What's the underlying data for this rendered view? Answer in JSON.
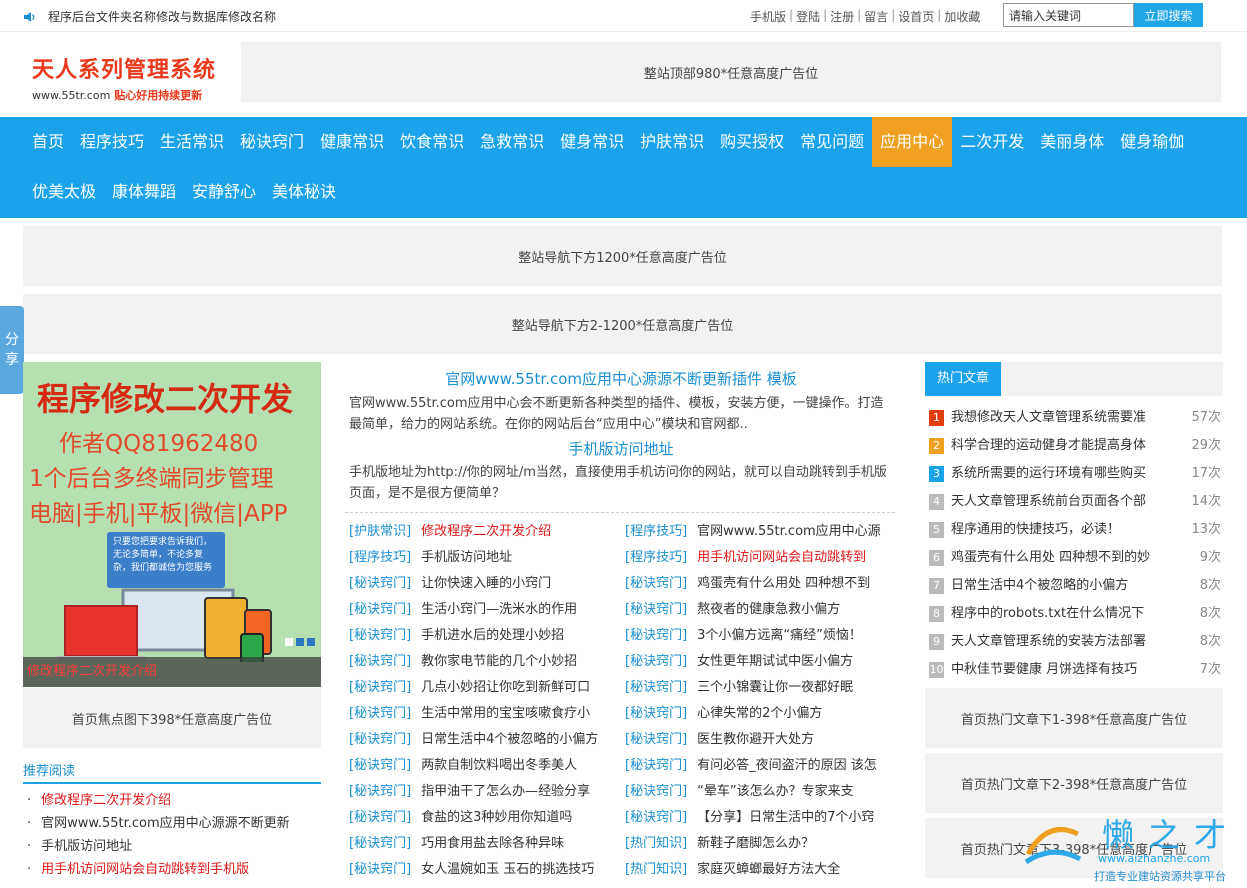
{
  "topbar": {
    "notice": "程序后台文件夹名称修改与数据库修改名称",
    "links": [
      "手机版",
      "登陆",
      "注册",
      "留言",
      "设首页",
      "加收藏"
    ],
    "search_placeholder": "请输入关键词",
    "search_button": "立即搜索"
  },
  "header": {
    "logo_title": "天人系列管理系统",
    "logo_domain": "www.55tr.com",
    "logo_slogan": "贴心好用持续更新",
    "top_ad": "整站顶部980*任意高度广告位"
  },
  "nav": {
    "row1": [
      "首页",
      "程序技巧",
      "生活常识",
      "秘诀窍门",
      "健康常识",
      "饮食常识",
      "急救常识",
      "健身常识",
      "护肤常识",
      "购买授权",
      "常见问题",
      "应用中心",
      "二次开发",
      "美丽身体",
      "健身瑜伽"
    ],
    "row2": [
      "优美太极",
      "康体舞蹈",
      "安静舒心",
      "美体秘诀"
    ],
    "active": "应用中心"
  },
  "ads": {
    "nav_ad1": "整站导航下方1200*任意高度广告位",
    "nav_ad2": "整站导航下方2-1200*任意高度广告位",
    "focus_ad": "首页焦点图下398*任意高度广告位",
    "hot_ad1": "首页热门文章下1-398*任意高度广告位",
    "hot_ad2": "首页热门文章下2-398*任意高度广告位",
    "hot_ad3": "首页热门文章下3-398*任意高度广告位"
  },
  "share": {
    "line1": "分",
    "line2": "享"
  },
  "focus": {
    "title": "程序修改二次开发",
    "author": "作者QQ81962480",
    "line3": "1个后台多终端同步管理",
    "line4": "电脑|手机|平板|微信|APP",
    "bubble": "只要您把要求告诉我们，无论多简单，不论多复杂，我们都诚信为您服务",
    "caption": "修改程序二次开发介绍"
  },
  "recommend": {
    "title": "推荐阅读",
    "items": [
      {
        "text": "修改程序二次开发介绍",
        "red": true
      },
      {
        "text": "官网www.55tr.com应用中心源源不断更新",
        "red": false
      },
      {
        "text": "手机版访问地址",
        "red": false
      },
      {
        "text": "用手机访问网站会自动跳转到手机版",
        "red": true
      }
    ]
  },
  "headline1": {
    "title": "官网www.55tr.com应用中心源源不断更新插件 模板",
    "desc": "官网www.55tr.com应用中心会不断更新各种类型的插件、模板，安装方便，一键操作。打造最简单，给力的网站系统。在你的网站后台“应用中心”模块和官网都.."
  },
  "headline2": {
    "title": "手机版访问地址",
    "desc": "手机版地址为http://你的网址/m当然，直接使用手机访问你的网站，就可以自动跳转到手机版页面，是不是很方便简单？"
  },
  "list_left": [
    {
      "cat": "[护肤常识]",
      "title": "修改程序二次开发介绍",
      "red": true
    },
    {
      "cat": "[程序技巧]",
      "title": "手机版访问地址",
      "red": false
    },
    {
      "cat": "[秘诀窍门]",
      "title": "让你快速入睡的小窍门",
      "red": false
    },
    {
      "cat": "[秘诀窍门]",
      "title": "生活小窍门—洗米水的作用",
      "red": false
    },
    {
      "cat": "[秘诀窍门]",
      "title": "手机进水后的处理小妙招",
      "red": false
    },
    {
      "cat": "[秘诀窍门]",
      "title": "教你家电节能的几个小妙招",
      "red": false
    },
    {
      "cat": "[秘诀窍门]",
      "title": "几点小妙招让你吃到新鲜可口",
      "red": false
    },
    {
      "cat": "[秘诀窍门]",
      "title": "生活中常用的宝宝咳嗽食疗小",
      "red": false
    },
    {
      "cat": "[秘诀窍门]",
      "title": "日常生活中4个被忽略的小偏方",
      "red": false
    },
    {
      "cat": "[秘诀窍门]",
      "title": "两款自制饮料喝出冬季美人",
      "red": false
    },
    {
      "cat": "[秘诀窍门]",
      "title": "指甲油干了怎么办—经验分享",
      "red": false
    },
    {
      "cat": "[秘诀窍门]",
      "title": "食盐的这3种妙用你知道吗",
      "red": false
    },
    {
      "cat": "[秘诀窍门]",
      "title": "巧用食用盐去除各种异味",
      "red": false
    },
    {
      "cat": "[秘诀窍门]",
      "title": "女人温婉如玉 玉石的挑选技巧",
      "red": false
    }
  ],
  "list_right": [
    {
      "cat": "[程序技巧]",
      "title": "官网www.55tr.com应用中心源",
      "red": false
    },
    {
      "cat": "[程序技巧]",
      "title": "用手机访问网站会自动跳转到",
      "red": true
    },
    {
      "cat": "[秘诀窍门]",
      "title": "鸡蛋壳有什么用处 四种想不到",
      "red": false
    },
    {
      "cat": "[秘诀窍门]",
      "title": "熬夜者的健康急救小偏方",
      "red": false
    },
    {
      "cat": "[秘诀窍门]",
      "title": "3个小偏方远离“痛经”烦恼！",
      "red": false
    },
    {
      "cat": "[秘诀窍门]",
      "title": "女性更年期试试中医小偏方",
      "red": false
    },
    {
      "cat": "[秘诀窍门]",
      "title": "三个小锦囊让你一夜都好眠",
      "red": false
    },
    {
      "cat": "[秘诀窍门]",
      "title": "心律失常的2个小偏方",
      "red": false
    },
    {
      "cat": "[秘诀窍门]",
      "title": "医生教你避开大处方",
      "red": false
    },
    {
      "cat": "[秘诀窍门]",
      "title": "有问必答_夜间盗汗的原因 该怎",
      "red": false
    },
    {
      "cat": "[秘诀窍门]",
      "title": "“晕车”该怎么办？专家来支",
      "red": false
    },
    {
      "cat": "[秘诀窍门]",
      "title": "【分享】日常生活中的7个小窍",
      "red": false
    },
    {
      "cat": "[热门知识]",
      "title": "新鞋子磨脚怎么办？",
      "red": false
    },
    {
      "cat": "[热门知识]",
      "title": "家庭灭蟑螂最好方法大全",
      "red": false
    }
  ],
  "hot": {
    "tab": "热门文章",
    "items": [
      {
        "n": "1",
        "title": "我想修改天人文章管理系统需要准",
        "count": "57次"
      },
      {
        "n": "2",
        "title": "科学合理的运动健身才能提高身体",
        "count": "29次"
      },
      {
        "n": "3",
        "title": "系统所需要的运行环境有哪些购买",
        "count": "17次"
      },
      {
        "n": "4",
        "title": "天人文章管理系统前台页面各个部",
        "count": "14次"
      },
      {
        "n": "5",
        "title": "程序通用的快捷技巧，必读！",
        "count": "13次"
      },
      {
        "n": "6",
        "title": "鸡蛋壳有什么用处 四种想不到的妙",
        "count": "9次"
      },
      {
        "n": "7",
        "title": "日常生活中4个被忽略的小偏方",
        "count": "8次"
      },
      {
        "n": "8",
        "title": "程序中的robots.txt在什么情况下",
        "count": "8次"
      },
      {
        "n": "9",
        "title": "天人文章管理系统的安装方法部署",
        "count": "8次"
      },
      {
        "n": "10",
        "title": "中秋佳节要健康 月饼选择有技巧",
        "count": "7次"
      }
    ]
  },
  "watermark": {
    "brand": "懒之才",
    "url": "www.aizhanzhe.com",
    "slogan": "打造专业建站资源共享平台"
  }
}
